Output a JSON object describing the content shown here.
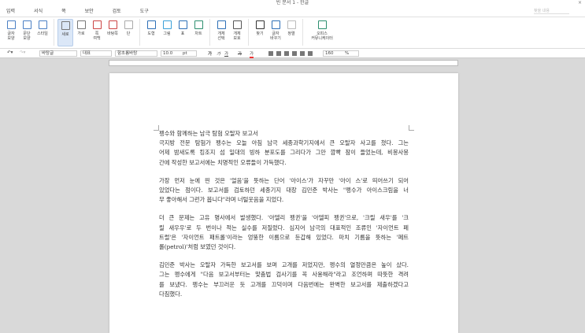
{
  "window": {
    "title": "빈 문서 1 - 한글",
    "close": "×",
    "search_placeholder": "찾을 내용"
  },
  "menu": [
    "입력",
    "서식",
    "쪽",
    "보안",
    "검토",
    "도구"
  ],
  "ribbon": [
    {
      "label": "글자\n모양",
      "icon": "char-shape-icon",
      "color": "#4a7fc4"
    },
    {
      "label": "문단\n모양",
      "icon": "para-shape-icon",
      "color": "#4a7fc4"
    },
    {
      "label": "스타일",
      "icon": "style-icon",
      "color": "#4a7fc4"
    },
    {
      "sep": true
    },
    {
      "label": "세로",
      "icon": "portrait-icon",
      "color": "#777",
      "selected": true
    },
    {
      "label": "가로",
      "icon": "landscape-icon",
      "color": "#777"
    },
    {
      "label": "쪽\n여백",
      "icon": "margin-icon",
      "color": "#c44"
    },
    {
      "label": "바탕쪽",
      "icon": "master-page-icon",
      "color": "#c44"
    },
    {
      "label": "단",
      "icon": "columns-icon",
      "color": "#aaa"
    },
    {
      "sep": true
    },
    {
      "label": "도형",
      "icon": "shape-icon",
      "color": "#2d6fb7"
    },
    {
      "label": "그림",
      "icon": "picture-icon",
      "color": "#3aa0d8"
    },
    {
      "label": "표",
      "icon": "table-icon",
      "color": "#2d6fb7"
    },
    {
      "label": "차트",
      "icon": "chart-icon",
      "color": "#2d8f6f"
    },
    {
      "sep": true
    },
    {
      "label": "개체\n선택",
      "icon": "select-object-icon",
      "color": "#2d6fb7"
    },
    {
      "label": "개체\n보호",
      "icon": "protect-object-icon",
      "color": "#555"
    },
    {
      "sep": true
    },
    {
      "label": "찾기",
      "icon": "binoculars-icon",
      "color": "#333"
    },
    {
      "label": "글자\n바꾸기",
      "icon": "replace-icon",
      "color": "#2d6fb7"
    },
    {
      "label": "정렬",
      "icon": "sort-icon",
      "color": "#bbb"
    },
    {
      "sep": true
    },
    {
      "label": "오피스\n커뮤니케이터",
      "icon": "communicator-icon",
      "color": "#2d8f6f",
      "wide": true
    }
  ],
  "format": {
    "style": "바탕글",
    "lang": "대표",
    "font": "함초롬바탕",
    "size": "10.0",
    "unit": "pt",
    "bold": "가",
    "italic": "가",
    "underline": "가",
    "strike": "가",
    "color": "가",
    "zoom": "160",
    "zoom_unit": "%"
  },
  "document": {
    "paragraphs": [
      [
        "펭수와 함께하는 남극 탐험 오탈자 보고서",
        "극지방 전문 탐험가 펭수는 오늘 아침 남극 세종과학기지에서 큰 오탈자 사고를 쳤다. 그는",
        "어제 밤새도록 킹조지 섬 일대의 빙하 분포도를 그리다가 그만 깜빡 잠이 들었는데, 비몽사몽",
        "간에 작성한 보고서에는 치명적인 오류들이 가득했다."
      ],
      [
        "가장 먼저 눈에 띈 것은 '얼음'을 뜻하는 단어 '아이스'가 자꾸만 '아이 스'로 띄어쓰기 되어",
        "있었다는 점이다. 보고서를 검토하던 세종기지 대장 김민준 박사는 \"펭수가 아이스크림을 너",
        "무 좋아해서 그런가 봅니다\"라며 너털웃음을 지었다."
      ],
      [
        "더 큰 문제는 고유 명사에서 발생했다. '아델리 펭귄'을 '아델피 펭귄'으로, '크릴 새우'를 '크",
        "릴 새우우'로 두 번이나 적는 실수를 저질렀다. 심지어 남극의 대표적인 조류인 '자이언트 페",
        "트럴'은 '자이언트 패트롤'이라는 엉뚱한 이름으로 둔갑해 있었다. 마치 기름을 뜻하는 '페트",
        "롤(petrol)'처럼 보였던 것이다."
      ],
      [
        "김민준 박사는 오탈자 가득한 보고서를 보며 고개를 저었지만, 펭수의 열정만큼은 높이 샀다.",
        "그는 펭수에게 \"다음 보고서부터는 맞춤법 검사기를 꼭 사용해라\"라고 조언하며 따뜻한 격려",
        "를 보냈다. 펭수는 부끄러운 듯 고개를 끄덕이며 다음번에는 완벽한 보고서를 제출하겠다고",
        "다짐했다."
      ]
    ]
  }
}
